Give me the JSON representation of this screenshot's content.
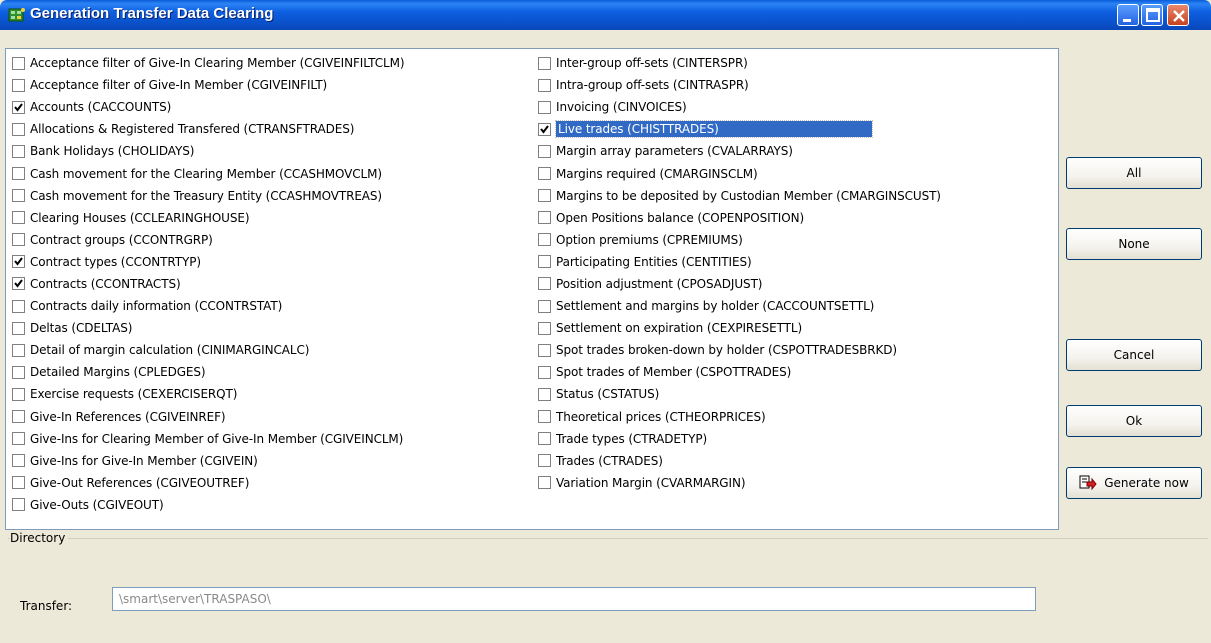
{
  "window": {
    "title": "Generation Transfer Data Clearing"
  },
  "tables_left": [
    {
      "label": "Acceptance filter of Give-In Clearing Member (CGIVEINFILTCLM)",
      "checked": false
    },
    {
      "label": "Acceptance filter of Give-In Member (CGIVEINFILT)",
      "checked": false
    },
    {
      "label": "Accounts (CACCOUNTS)",
      "checked": true
    },
    {
      "label": "Allocations & Registered Transfered (CTRANSFTRADES)",
      "checked": false
    },
    {
      "label": "Bank Holidays (CHOLIDAYS)",
      "checked": false
    },
    {
      "label": "Cash movement for the Clearing Member (CCASHMOVCLM)",
      "checked": false
    },
    {
      "label": "Cash movement for the Treasury Entity (CCASHMOVTREAS)",
      "checked": false
    },
    {
      "label": "Clearing Houses (CCLEARINGHOUSE)",
      "checked": false
    },
    {
      "label": "Contract groups (CCONTRGRP)",
      "checked": false
    },
    {
      "label": "Contract types (CCONTRTYP)",
      "checked": true
    },
    {
      "label": "Contracts (CCONTRACTS)",
      "checked": true
    },
    {
      "label": "Contracts daily information (CCONTRSTAT)",
      "checked": false
    },
    {
      "label": "Deltas (CDELTAS)",
      "checked": false
    },
    {
      "label": "Detail of margin calculation (CINIMARGINCALC)",
      "checked": false
    },
    {
      "label": "Detailed Margins (CPLEDGES)",
      "checked": false
    },
    {
      "label": "Exercise requests (CEXERCISERQT)",
      "checked": false
    },
    {
      "label": "Give-In References (CGIVEINREF)",
      "checked": false
    },
    {
      "label": "Give-Ins for Clearing Member of Give-In Member (CGIVEINCLM)",
      "checked": false
    },
    {
      "label": "Give-Ins for Give-In Member (CGIVEIN)",
      "checked": false
    },
    {
      "label": "Give-Out References (CGIVEOUTREF)",
      "checked": false
    },
    {
      "label": "Give-Outs (CGIVEOUT)",
      "checked": false
    }
  ],
  "tables_right": [
    {
      "label": "Inter-group off-sets (CINTERSPR)",
      "checked": false
    },
    {
      "label": "Intra-group off-sets (CINTRASPR)",
      "checked": false
    },
    {
      "label": "Invoicing (CINVOICES)",
      "checked": false
    },
    {
      "label": "Live trades (CHISTTRADES)",
      "checked": true,
      "selected": true
    },
    {
      "label": "Margin array parameters (CVALARRAYS)",
      "checked": false
    },
    {
      "label": "Margins required (CMARGINSCLM)",
      "checked": false
    },
    {
      "label": "Margins to be deposited by Custodian Member (CMARGINSCUST)",
      "checked": false
    },
    {
      "label": "Open Positions balance (COPENPOSITION)",
      "checked": false
    },
    {
      "label": "Option premiums (CPREMIUMS)",
      "checked": false
    },
    {
      "label": "Participating Entities (CENTITIES)",
      "checked": false
    },
    {
      "label": "Position adjustment (CPOSADJUST)",
      "checked": false
    },
    {
      "label": "Settlement and margins by holder (CACCOUNTSETTL)",
      "checked": false
    },
    {
      "label": "Settlement on expiration (CEXPIRESETTL)",
      "checked": false
    },
    {
      "label": "Spot trades broken-down by holder (CSPOTTRADESBRKD)",
      "checked": false
    },
    {
      "label": "Spot trades of Member (CSPOTTRADES)",
      "checked": false
    },
    {
      "label": "Status (CSTATUS)",
      "checked": false
    },
    {
      "label": "Theoretical prices (CTHEORPRICES)",
      "checked": false
    },
    {
      "label": "Trade types (CTRADETYP)",
      "checked": false
    },
    {
      "label": "Trades (CTRADES)",
      "checked": false
    },
    {
      "label": "Variation Margin (CVARMARGIN)",
      "checked": false
    }
  ],
  "buttons": {
    "all": "All",
    "none": "None",
    "cancel": "Cancel",
    "ok": "Ok",
    "generate_now": "Generate now"
  },
  "directory": {
    "legend": "Directory",
    "transfer_label": "Transfer:",
    "transfer_value": "\\smart\\server\\TRASPASO\\"
  },
  "colors": {
    "selection": "#316ac5",
    "titlebar": "#0a5ad8",
    "background": "#ece9d8"
  },
  "icons": {
    "app": "app-icon",
    "generate": "generate-now-icon"
  }
}
